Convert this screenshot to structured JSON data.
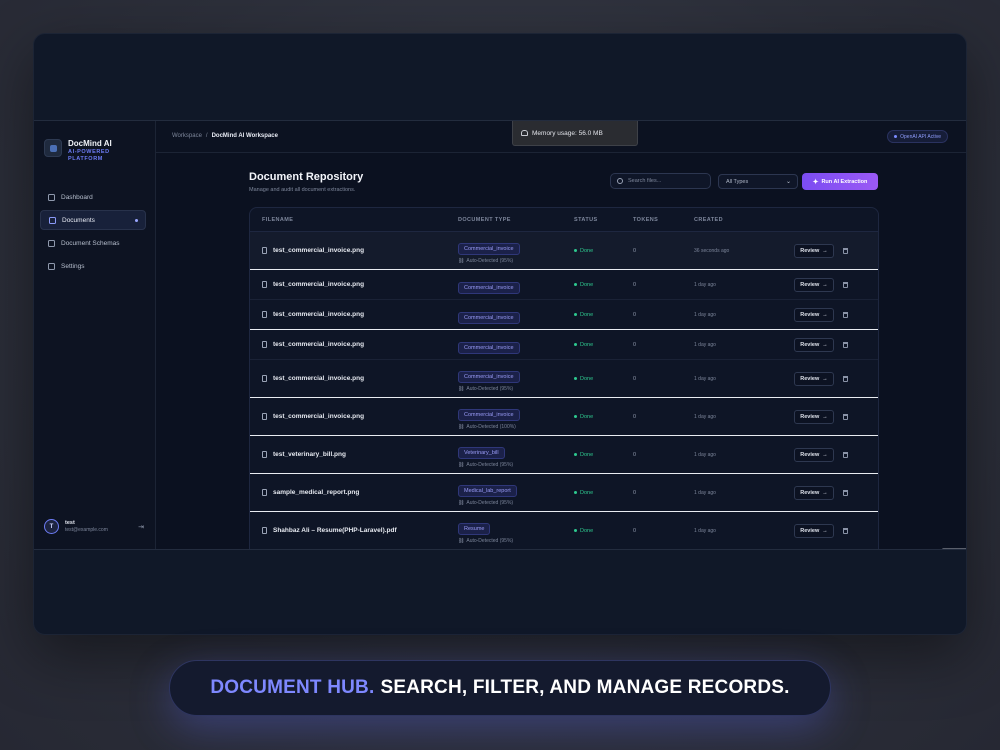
{
  "brand": {
    "name": "DocMind AI",
    "tagline": "AI-POWERED PLATFORM"
  },
  "sidebar": {
    "items": [
      {
        "label": "Dashboard",
        "icon": "grid-icon",
        "active": false
      },
      {
        "label": "Documents",
        "icon": "document-icon",
        "active": true
      },
      {
        "label": "Document Schemas",
        "icon": "database-icon",
        "active": false
      },
      {
        "label": "Settings",
        "icon": "sliders-icon",
        "active": false
      }
    ],
    "user": {
      "initial": "T",
      "name": "test",
      "email": "test@example.com"
    }
  },
  "header": {
    "breadcrumb_root": "Workspace",
    "breadcrumb_sep": "/",
    "breadcrumb_current": "DocMind AI Workspace",
    "api_status": "OpenAI API Active",
    "memory_usage": "Memory usage: 56.0 MB"
  },
  "main": {
    "title": "Document Repository",
    "subtitle": "Manage and audit all document extractions.",
    "search_placeholder": "Search files...",
    "type_filter": "All Types",
    "run_button": "Run AI Extraction"
  },
  "table": {
    "columns": [
      "FILENAME",
      "DOCUMENT TYPE",
      "STATUS",
      "TOKENS",
      "CREATED"
    ],
    "review_label": "Review",
    "review_arrow": "→",
    "rows": [
      {
        "filename": "test_commercial_invoice.png",
        "type": "Commercial_invoice",
        "auto": "Auto-Detected (95%)",
        "status": "Done",
        "tokens": "0",
        "created": "36 seconds ago"
      },
      {
        "filename": "test_commercial_invoice.png",
        "type": "Commercial_invoice",
        "auto": "",
        "status": "Done",
        "tokens": "0",
        "created": "1 day ago"
      },
      {
        "filename": "test_commercial_invoice.png",
        "type": "Commercial_invoice",
        "auto": "",
        "status": "Done",
        "tokens": "0",
        "created": "1 day ago"
      },
      {
        "filename": "test_commercial_invoice.png",
        "type": "Commercial_invoice",
        "auto": "",
        "status": "Done",
        "tokens": "0",
        "created": "1 day ago"
      },
      {
        "filename": "test_commercial_invoice.png",
        "type": "Commercial_invoice",
        "auto": "Auto-Detected (95%)",
        "status": "Done",
        "tokens": "0",
        "created": "1 day ago"
      },
      {
        "filename": "test_commercial_invoice.png",
        "type": "Commercial_invoice",
        "auto": "Auto-Detected (100%)",
        "status": "Done",
        "tokens": "0",
        "created": "1 day ago"
      },
      {
        "filename": "test_veterinary_bill.png",
        "type": "Veterinary_bill",
        "auto": "Auto-Detected (95%)",
        "status": "Done",
        "tokens": "0",
        "created": "1 day ago"
      },
      {
        "filename": "sample_medical_report.png",
        "type": "Medical_lab_report",
        "auto": "Auto-Detected (95%)",
        "status": "Done",
        "tokens": "0",
        "created": "1 day ago"
      },
      {
        "filename": "Shahbaz Ali – Resume(PHP-Laravel).pdf",
        "type": "Resume",
        "auto": "Auto-Detected (95%)",
        "status": "Done",
        "tokens": "0",
        "created": "1 day ago"
      }
    ]
  },
  "caption": {
    "accent": "DOCUMENT HUB.",
    "text": "SEARCH, FILTER, AND MANAGE RECORDS."
  },
  "colors": {
    "accent": "#7e88ff",
    "status_done": "#2ec98f",
    "run_button": "#8b52f4"
  }
}
